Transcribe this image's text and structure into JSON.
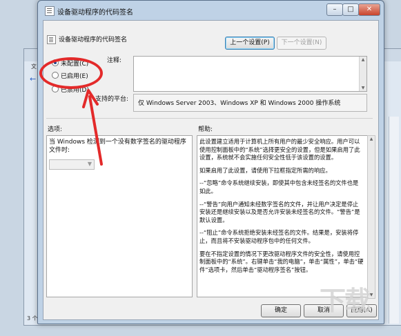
{
  "background_window": {
    "menu_label": "文",
    "status_text": "3 个"
  },
  "dialog": {
    "title": "设备驱动程序的代码签名",
    "controls": {
      "minimize": "–",
      "maximize": "□",
      "close": "✕"
    }
  },
  "header": {
    "policy_name": "设备驱动程序的代码签名",
    "prev_button": "上一个设置(P)",
    "next_button": "下一个设置(N)"
  },
  "radios": [
    {
      "label": "未配置(C)",
      "checked": true
    },
    {
      "label": "已启用(E)",
      "checked": false
    },
    {
      "label": "已禁用(D)",
      "checked": false
    }
  ],
  "comment_label": "注释:",
  "platform": {
    "label": "支持的平台:",
    "value": "仅 Windows Server 2003、Windows XP 和 Windows 2000 操作系统"
  },
  "options": {
    "label": "选项:",
    "text": "当 Windows 检测到一个没有数字签名的驱动程序文件时:"
  },
  "help": {
    "label": "帮助:",
    "paragraphs": [
      "此设置建立适用于计算机上所有用户的最少安全响应。用户可以使用控制面板中的“系统”选择更安全的设置，但是如果启用了此设置，系统就不会实施任何安全性低于该设置的设置。",
      "如果启用了此设置，请使用下拉框指定所需的响应。",
      "--“忽略”命令系统继续安装，即使其中包含未经签名的文件也是如此。",
      "--“警告”向用户通知未经数字签名的文件，并让用户决定是停止安装还是继续安装以及是否允许安装未经签名的文件。“警告”是默认设置。",
      "--“阻止”命令系统拒绝安装未经签名的文件。结果是，安装将停止，而且将不安装驱动程序包中的任何文件。",
      "要在不指定设置的情况下更改驱动程序文件的安全性，请使用控制面板中的“系统”。右键单击“我的电脑”，单击“属性”，单击“硬件”选项卡，然后单击“驱动程序签名”按钮。"
    ]
  },
  "footer": {
    "ok": "确定",
    "cancel": "取消",
    "apply": "应用(A)"
  },
  "annotation_color": "#e32a2a",
  "watermark": "下载"
}
